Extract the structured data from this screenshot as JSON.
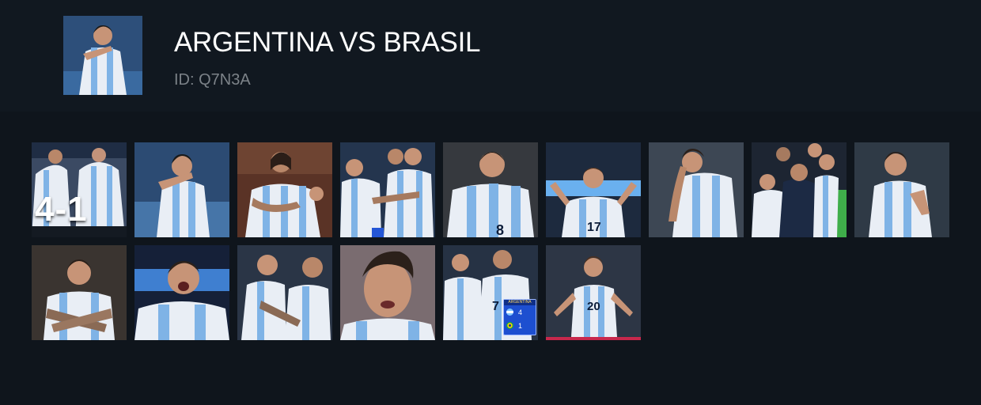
{
  "header": {
    "title": "ARGENTINA VS BRASIL",
    "subtitle": "ID: Q7N3A"
  },
  "overlays": {
    "scoreline": "4-1",
    "badge_header": "ARGENTINA",
    "home_score": "4",
    "away_score": "1"
  },
  "jerseys": {
    "p8": "8",
    "p17": "17",
    "p20": "20",
    "p7": "7"
  },
  "colors": {
    "background": "#0f151c",
    "header_bg": "#111820",
    "title": "#ffffff",
    "subtitle": "#7c8288",
    "jersey_blue": "#7fb3e6"
  }
}
